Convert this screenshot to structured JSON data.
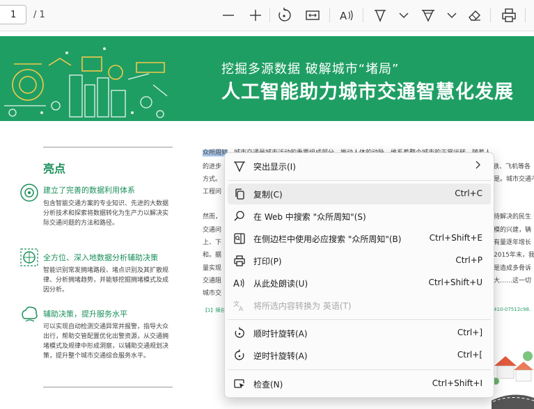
{
  "toolbar": {
    "page_current": "1",
    "page_total": "/ 1"
  },
  "banner": {
    "subtitle": "挖掘多源数据 破解城市“堵局”",
    "title": "人工智能助力城市交通智慧化发展"
  },
  "highlights": {
    "title": "亮点",
    "features": [
      {
        "head": "建立了完善的数据利用体系",
        "body": "包含智能交通方案的专业知识、先进的大数据分析技术和探索将数据转化为生产力以解决实际交通问题的方法和路径。"
      },
      {
        "head": "全方位、深入地数据分析辅助决策",
        "body": "智能识别常发拥堵路段、堵点识别及其扩散规律、分析拥堵趋势，并能够挖掘拥堵模式及成因分析。"
      },
      {
        "head": "辅助决策，提升服务水平",
        "body": "可以实现自动检测交通异常并报警，指导大众出行，帮助交管配置优化出警资源，从交通拥堵模式及规律中形成洞察，以辅助交通规划决策，提升整个城市交通综合服务水平。"
      }
    ]
  },
  "body_text": {
    "selected": "众所周知",
    "lines_visible": [
      "，城市交通是城市活动的重要组成部分，推动人体的动脉，维系着整个城市的正常运转。随着人",
      "的进步",
      "铁、飞机等各",
      "方式。",
      "是。城市交通不",
      "工程问",
      "然而，",
      "待解决的民生",
      "交通问",
      "模的兴建，辆",
      "上、下",
      "有量逐年增长",
      "和。据",
      "2015年末，我",
      "量实现",
      "是造成多骨诉",
      "交通阻",
      "大……这一切",
      "城市交"
    ],
    "footnote_left": "【1】摘自",
    "footnote_right": "410-07512c98."
  },
  "context_menu": {
    "items": [
      {
        "icon": "highlight-icon",
        "label": "突出显示(I)",
        "shortcut": "",
        "submenu": true,
        "hover": false,
        "disabled": false
      },
      {
        "icon": "copy-icon",
        "label": "复制(C)",
        "shortcut": "Ctrl+C",
        "submenu": false,
        "hover": true,
        "disabled": false
      },
      {
        "icon": "search-icon",
        "label": "在 Web 中搜索 \"众所周知\"(S)",
        "shortcut": "",
        "submenu": false,
        "hover": false,
        "disabled": false
      },
      {
        "icon": "sidebar-search-icon",
        "label": "在侧边栏中使用必应搜索 \"众所周知\"(B)",
        "shortcut": "Ctrl+Shift+E",
        "submenu": false,
        "hover": false,
        "disabled": false
      },
      {
        "icon": "print-icon",
        "label": "打印(P)",
        "shortcut": "Ctrl+P",
        "submenu": false,
        "hover": false,
        "disabled": false
      },
      {
        "icon": "read-aloud-icon",
        "label": "从此处朗读(U)",
        "shortcut": "Ctrl+Shift+U",
        "submenu": false,
        "hover": false,
        "disabled": false
      },
      {
        "icon": "translate-icon",
        "label": "将所选内容转换为 英语(T)",
        "shortcut": "",
        "submenu": false,
        "hover": false,
        "disabled": true
      },
      {
        "icon": "rotate-clockwise-icon",
        "label": "顺时针旋转(A)",
        "shortcut": "Ctrl+]",
        "submenu": false,
        "hover": false,
        "disabled": false
      },
      {
        "icon": "rotate-counterclockwise-icon",
        "label": "逆时针旋转(A)",
        "shortcut": "Ctrl+[",
        "submenu": false,
        "hover": false,
        "disabled": false
      },
      {
        "icon": "inspect-icon",
        "label": "检查(N)",
        "shortcut": "Ctrl+Shift+I",
        "submenu": false,
        "hover": false,
        "disabled": false
      }
    ]
  },
  "colors": {
    "banner_green": "#1f9e64",
    "accent_green": "#1a8f5a",
    "selection": "#a9c6ea",
    "menu_hover": "#ececec"
  }
}
